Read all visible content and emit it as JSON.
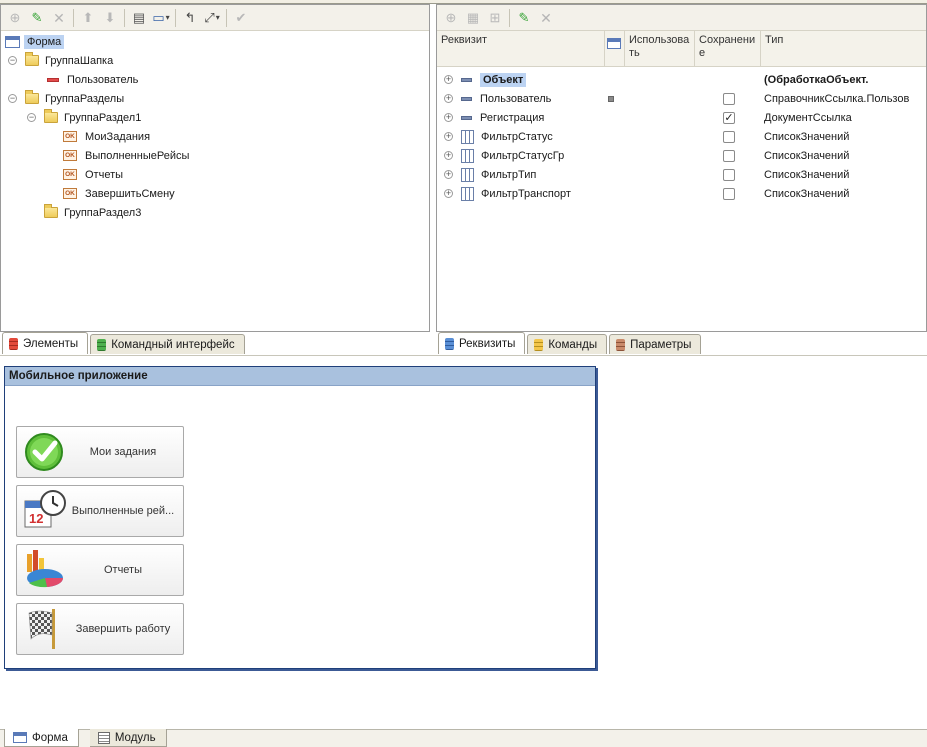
{
  "left_panel": {
    "tree": [
      {
        "label": "Форма",
        "selected": true
      },
      {
        "label": "ГруппаШапка"
      },
      {
        "label": "Пользователь"
      },
      {
        "label": "ГруппаРазделы"
      },
      {
        "label": "ГруппаРаздел1"
      },
      {
        "label": "МоиЗадания"
      },
      {
        "label": "ВыполненныеРейсы"
      },
      {
        "label": "Отчеты"
      },
      {
        "label": "ЗавершитьСмену"
      },
      {
        "label": "ГруппаРаздел3"
      }
    ],
    "tabs": [
      {
        "label": "Элементы",
        "active": true
      },
      {
        "label": "Командный интерфейс"
      }
    ]
  },
  "right_panel": {
    "columns": [
      "Реквизит",
      "Использова ть",
      "Сохранени е",
      "Тип"
    ],
    "rows": [
      {
        "name": "Объект",
        "type": "(ОбработкаОбъект.",
        "saved": false,
        "bold": true
      },
      {
        "name": "Пользователь",
        "type": "СправочникСсылка.Пользов",
        "saved": false
      },
      {
        "name": "Регистрация",
        "type": "ДокументСсылка",
        "saved": true
      },
      {
        "name": "ФильтрСтатус",
        "type": "СписокЗначений",
        "saved": false
      },
      {
        "name": "ФильтрСтатусГр",
        "type": "СписокЗначений",
        "saved": false
      },
      {
        "name": "ФильтрТип",
        "type": "СписокЗначений",
        "saved": false
      },
      {
        "name": "ФильтрТранспорт",
        "type": "СписокЗначений",
        "saved": false
      }
    ],
    "tabs": [
      {
        "label": "Реквизиты",
        "active": true
      },
      {
        "label": "Команды"
      },
      {
        "label": "Параметры"
      }
    ]
  },
  "designer": {
    "title": "Мобильное приложение",
    "buttons": [
      {
        "label": "Мои задания",
        "icon": "checkmark-icon"
      },
      {
        "label": "Выполненные рей...",
        "icon": "calendar-clock-icon"
      },
      {
        "label": "Отчеты",
        "icon": "pie-chart-icon"
      },
      {
        "label": "Завершить работу",
        "icon": "finish-flag-icon"
      }
    ]
  },
  "bottom_tabs": [
    {
      "label": "Форма",
      "active": true
    },
    {
      "label": "Модуль"
    }
  ],
  "colors": {
    "selection": "#bcd3f2",
    "title_bar": "#a9c1de",
    "accent_green": "#3aa53a"
  }
}
